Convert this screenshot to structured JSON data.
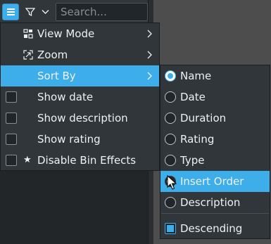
{
  "toolbar": {
    "menu_icon": "hamburger-menu-icon",
    "filter_icon": "filter-icon",
    "dropdown_icon": "chevron-down-icon",
    "search_placeholder": "Search..."
  },
  "main_menu": {
    "items": [
      {
        "label": "View Mode",
        "icon": "view-mode-icon",
        "has_submenu": true
      },
      {
        "label": "Zoom",
        "icon": "zoom-icon",
        "has_submenu": true
      },
      {
        "label": "Sort By",
        "has_submenu": true,
        "highlighted": true
      },
      {
        "label": "Show date",
        "checkbox": true,
        "checked": false
      },
      {
        "label": "Show description",
        "checkbox": true,
        "checked": false
      },
      {
        "label": "Show rating",
        "checkbox": true,
        "checked": false
      },
      {
        "label": "Disable Bin Effects",
        "checkbox": true,
        "checked": false,
        "icon": "star-icon"
      }
    ]
  },
  "sort_menu": {
    "options": [
      {
        "label": "Name",
        "selected": true
      },
      {
        "label": "Date",
        "selected": false
      },
      {
        "label": "Duration",
        "selected": false
      },
      {
        "label": "Rating",
        "selected": false
      },
      {
        "label": "Type",
        "selected": false
      },
      {
        "label": "Insert Order",
        "selected": false,
        "highlighted": true
      },
      {
        "label": "Description",
        "selected": false
      }
    ],
    "descending": {
      "label": "Descending",
      "checked": true
    }
  },
  "colors": {
    "accent": "#3daee9",
    "menu_bg": "#31363b",
    "text": "#eff0f1"
  }
}
